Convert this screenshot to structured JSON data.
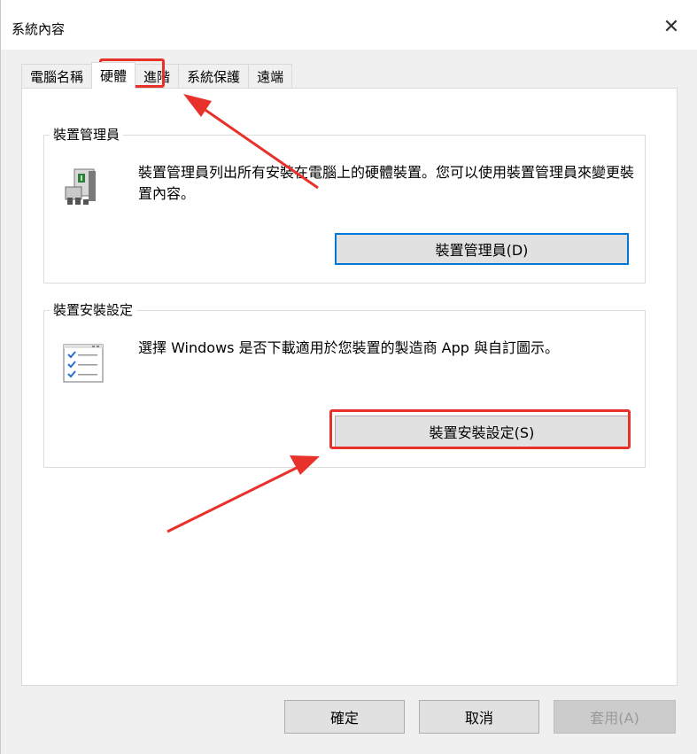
{
  "window": {
    "title": "系統內容",
    "close_symbol": "✕"
  },
  "tabs": [
    {
      "label": "電腦名稱",
      "active": false
    },
    {
      "label": "硬體",
      "active": true
    },
    {
      "label": "進階",
      "active": false
    },
    {
      "label": "系統保護",
      "active": false
    },
    {
      "label": "遠端",
      "active": false
    }
  ],
  "device_manager": {
    "group_label": "裝置管理員",
    "description": "裝置管理員列出所有安裝在電腦上的硬體裝置。您可以使用裝置管理員來變更裝置內容。",
    "button_label": "裝置管理員(D)",
    "icon": "device-manager-icon"
  },
  "device_install": {
    "group_label": "裝置安裝設定",
    "description": "選擇 Windows 是否下載適用於您裝置的製造商 App 與自訂圖示。",
    "button_label": "裝置安裝設定(S)",
    "icon": "checklist-icon"
  },
  "footer": {
    "ok_label": "確定",
    "cancel_label": "取消",
    "apply_label": "套用(A)"
  },
  "colors": {
    "accent": "#0078d7",
    "annotation": "#e8312b"
  }
}
